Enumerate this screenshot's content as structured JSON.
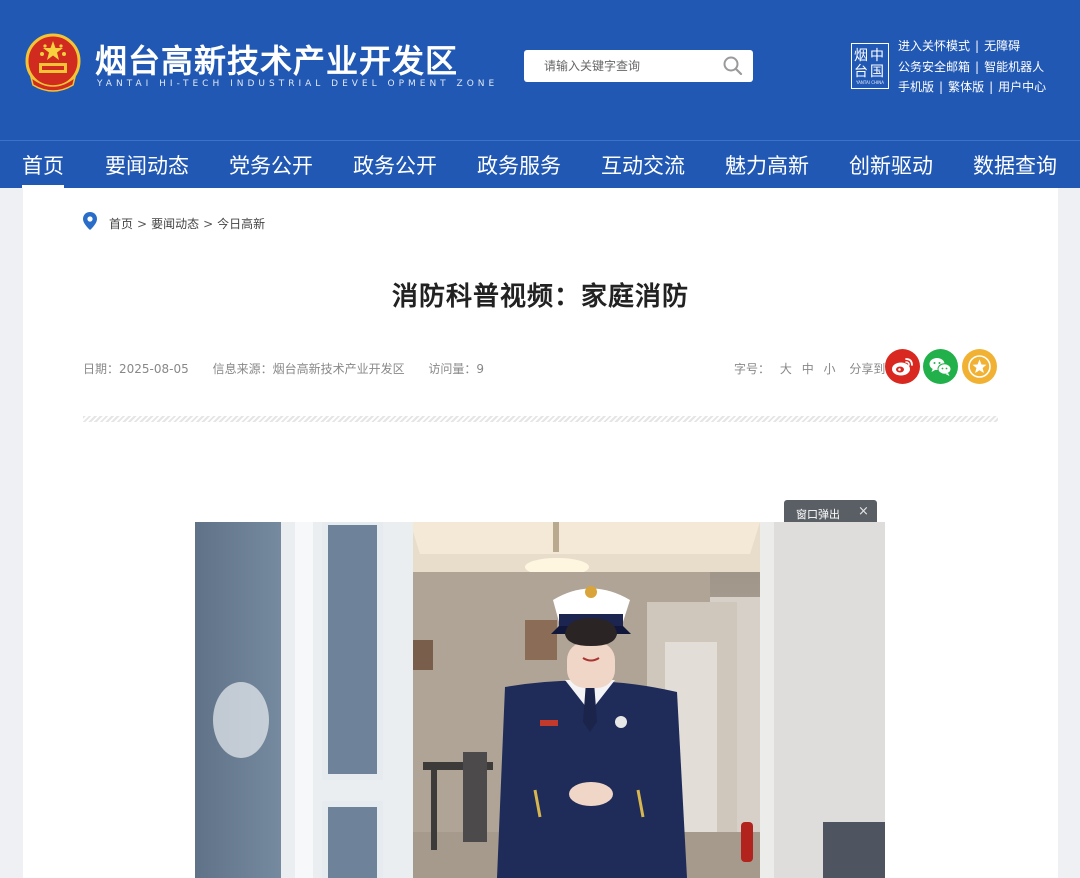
{
  "header": {
    "site_title": "烟台高新技术产业开发区",
    "site_subtitle": "YANTAI HI-TECH INDUSTRIAL DEVEL OPMENT ZONE",
    "seal_text": "烟中台国",
    "seal_sub": "YANTAI CHINA",
    "search": {
      "placeholder": "请输入关键字查询"
    },
    "quick_links": {
      "care_mode": "进入关怀模式",
      "accessibility": "无障碍",
      "official_mail": "公务安全邮箱",
      "robot": "智能机器人",
      "mobile": "手机版",
      "traditional": "繁体版",
      "user_center": "用户中心"
    },
    "separator": "|"
  },
  "nav": {
    "items": [
      "首页",
      "要闻动态",
      "党务公开",
      "政务公开",
      "政务服务",
      "互动交流",
      "魅力高新",
      "创新驱动",
      "数据查询"
    ]
  },
  "breadcrumb": {
    "items": [
      "首页",
      "要闻动态",
      "今日高新"
    ],
    "separator": ">"
  },
  "article": {
    "title": "消防科普视频：家庭消防",
    "date": "日期：2025-08-05",
    "source": "信息来源：烟台高新技术产业开发区",
    "views": "访问量：9"
  },
  "tools": {
    "font_label": "字号：",
    "font_large": "大",
    "font_medium": "中",
    "font_small": "小",
    "share_label": "分享到："
  },
  "video": {
    "popup_label": "窗口弹出",
    "close_glyph": "×"
  },
  "colors": {
    "brand_blue": "#2158b4",
    "weibo_red": "#d8281f",
    "wechat_green": "#22b04a",
    "favorite_gold": "#f1b233"
  }
}
